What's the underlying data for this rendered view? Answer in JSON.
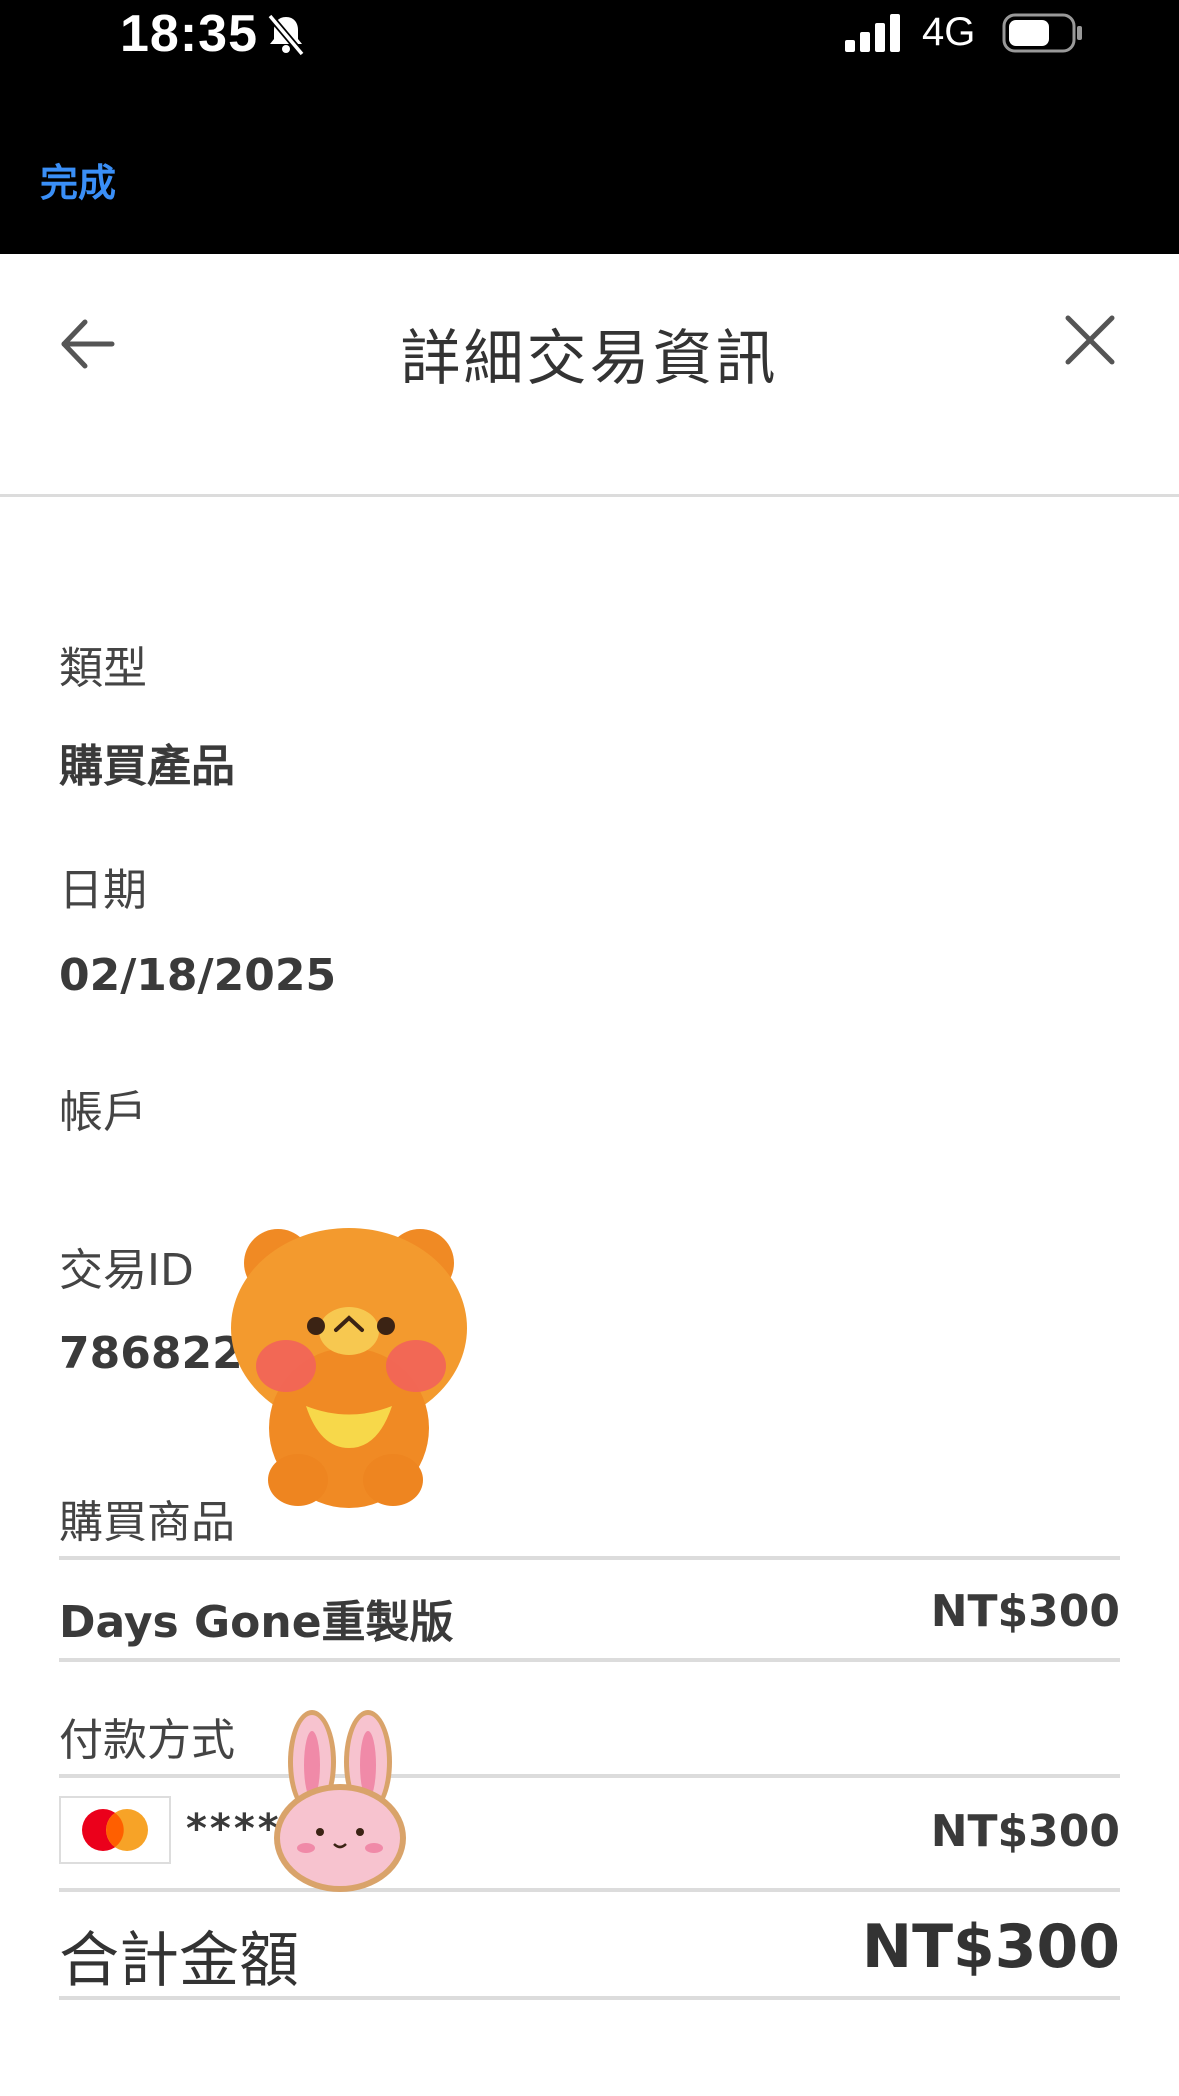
{
  "status_bar": {
    "time": "18:35",
    "network": "4G"
  },
  "nav": {
    "done_label": "完成"
  },
  "header": {
    "title": "詳細交易資訊"
  },
  "fields": [
    {
      "label": "類型",
      "value": "購買產品"
    },
    {
      "label": "日期",
      "value": "02/18/2025"
    },
    {
      "label": "帳戶",
      "value": ""
    },
    {
      "label": "交易ID",
      "value": "7868225"
    }
  ],
  "purchase": {
    "section_label": "購買商品",
    "item_name": "Days Gone重製版",
    "item_price": "NT$300"
  },
  "payment": {
    "section_label": "付款方式",
    "card_masked": "****",
    "amount": "NT$300"
  },
  "total": {
    "label": "合計金額",
    "value": "NT$300"
  },
  "colors": {
    "accent": "#3a8ff7",
    "divider": "#dcdcdc",
    "mastercard_red": "#eb001b",
    "mastercard_orange": "#f79e1b"
  }
}
